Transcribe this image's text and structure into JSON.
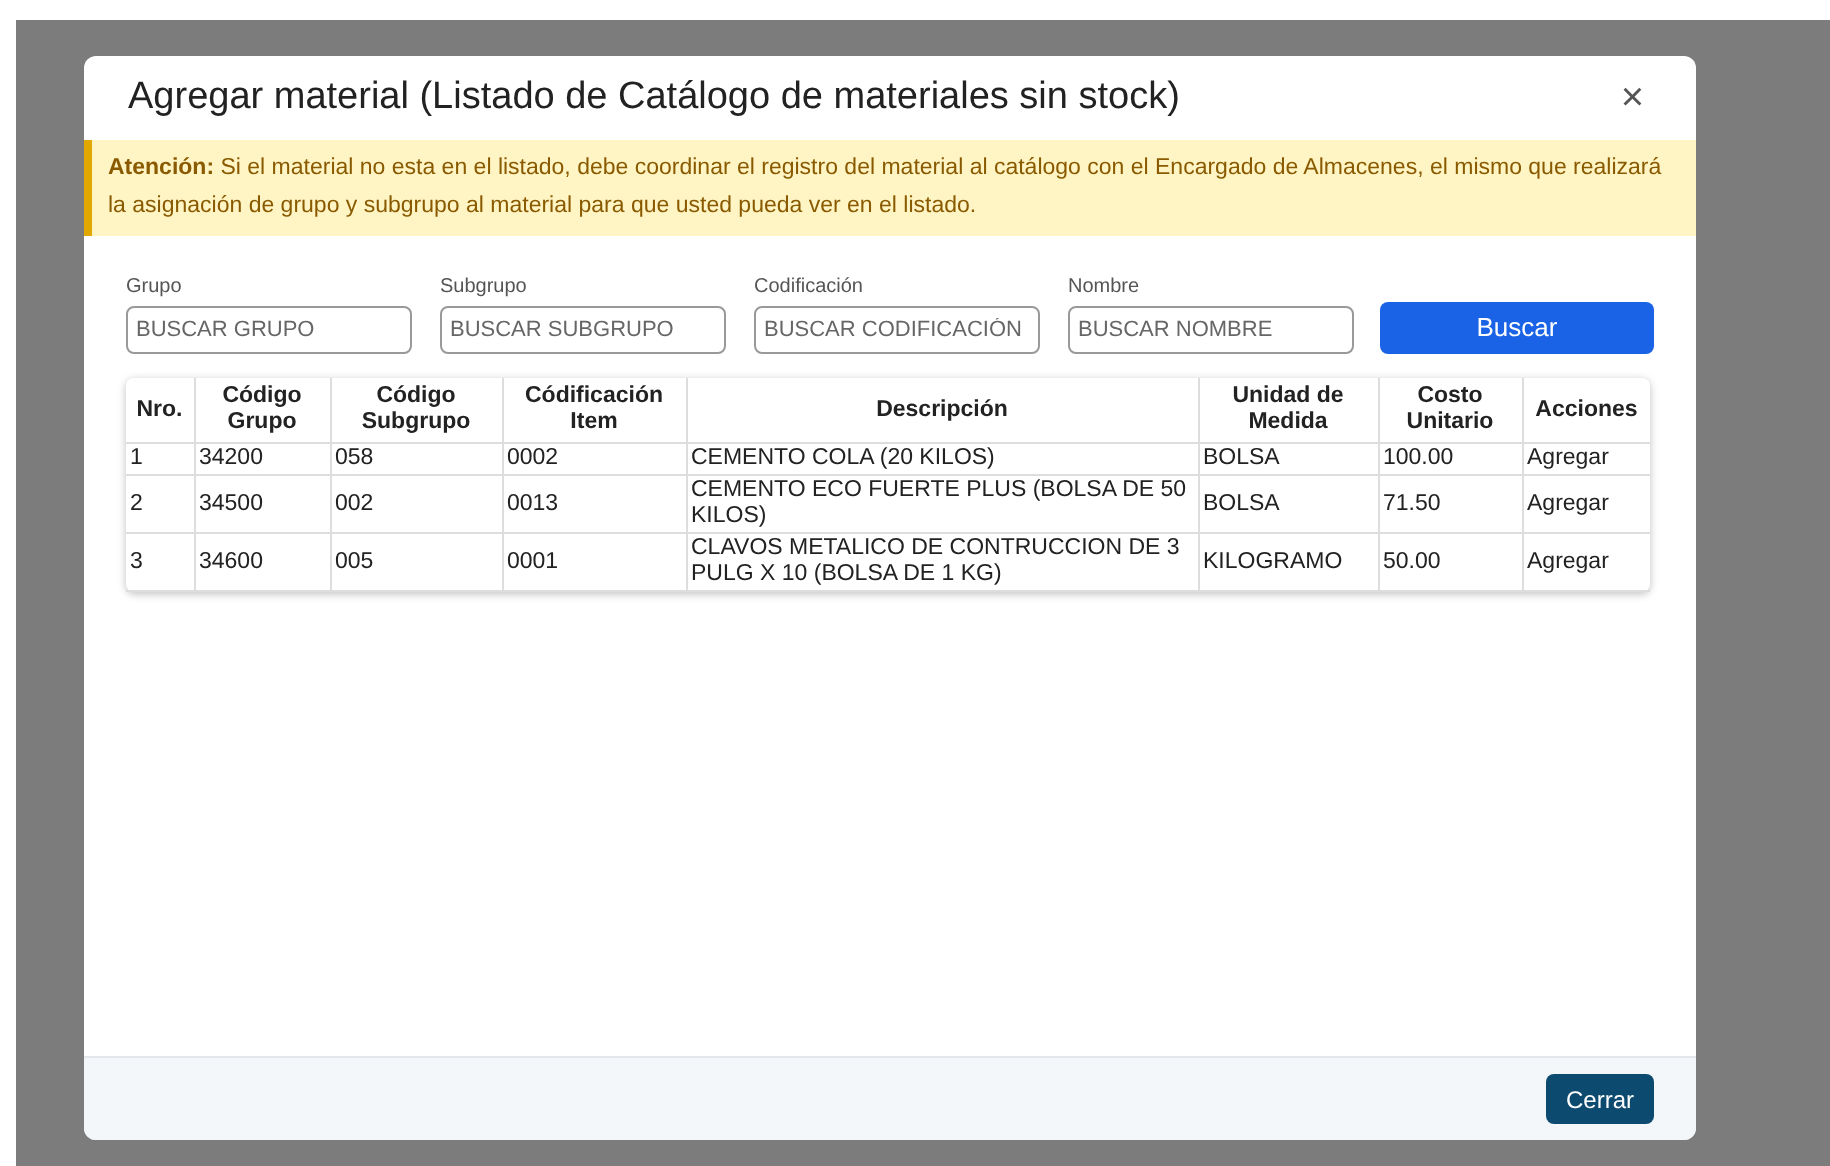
{
  "modal": {
    "title": "Agregar material (Listado de Catálogo de materiales sin stock)",
    "close": "×"
  },
  "alert": {
    "text": "**Atención:** Si el material no esta en el listado, debe coordinar el registro del material al catálogo con el Encargado de Almacenes, el mismo que realizará la asignación de grupo y subgrupo al material para que usted pueda ver en el listado."
  },
  "filters": [
    {
      "label": "Grupo",
      "placeholder": "BUSCAR GRUPO"
    },
    {
      "label": "Subgrupo",
      "placeholder": "BUSCAR SUBGRUPO"
    },
    {
      "label": "Codificación",
      "placeholder": "BUSCAR CODIFICACIÓN"
    },
    {
      "label": "Nombre",
      "placeholder": "BUSCAR NOMBRE"
    }
  ],
  "search_button": "Buscar",
  "table": {
    "columns": [
      "Nro.",
      "Código Grupo",
      "Código Subgrupo",
      "Códificación Item",
      "Descripción",
      "Unidad de Medida",
      "Costo Unitario",
      "Acciones"
    ],
    "rows": [
      [
        "1",
        "34200",
        "058",
        "0002",
        "CEMENTO COLA (20 KILOS)",
        "BOLSA",
        "100.00",
        "Agregar"
      ],
      [
        "2",
        "34500",
        "002",
        "0013",
        "CEMENTO ECO FUERTE PLUS (BOLSA DE 50 KILOS)",
        "BOLSA",
        "71.50",
        "Agregar"
      ],
      [
        "3",
        "34600",
        "005",
        "0001",
        "CLAVOS METALICO DE CONTRUCCION DE 3 PULG X 10 (BOLSA DE 1 KG)",
        "KILOGRAMO",
        "50.00",
        "Agregar"
      ]
    ]
  },
  "footer_button": "Cerrar"
}
